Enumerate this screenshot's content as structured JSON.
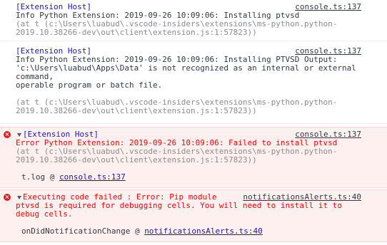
{
  "messages": [
    {
      "source": "console.ts:137",
      "lines": [
        "[Extension Host]",
        "Info Python Extension: 2019-09-26 10:09:06: Installing ptvsd",
        "(at t (c:\\Users\\luabud\\.vscode-insiders\\extensions\\ms-python.python-",
        "2019.10.38266-dev\\out\\client\\extension.js:1:57823))"
      ]
    },
    {
      "source": "console.ts:137",
      "lines": [
        "[Extension Host]",
        "Info Python Extension: 2019-09-26 10:09:06: Installing PTVSD Output:",
        "'c:\\Users\\luabud\\Apps\\Data' is not recognized as an internal or external",
        "command,",
        "operable program or batch file.",
        "(at t (c:\\Users\\luabud\\.vscode-insiders\\extensions\\ms-python.python-",
        "2019.10.38266-dev\\out\\client\\extension.js:1:57823))"
      ]
    },
    {
      "source": "console.ts:137",
      "lines": [
        "[Extension Host]",
        "Error Python Extension: 2019-09-26 10:09:06: Failed to install ptvsd",
        "(at t (c:\\Users\\luabud\\.vscode-insiders\\extensions\\ms-python.python-",
        "2019.10.38266-dev\\out\\client\\extension.js:1:57823))"
      ],
      "stack_prefix": "t.log @ ",
      "stack_link": "console.ts:137"
    },
    {
      "source": "notificationsAlerts.ts:40",
      "lines": [
        "Executing code failed : Error: Pip module",
        "ptvsd is required for debugging cells. You will need to install it to",
        "debug cells."
      ],
      "stack_prefix": "onDidNotificationChange @ ",
      "stack_link": "notificationsAlerts.ts:40"
    }
  ],
  "colors": {
    "error_text": "#ff0000",
    "error_background": "#fff0f0",
    "link": "#1a1aa6",
    "gray": "#8b8b8b"
  },
  "icons": {
    "error": "error-circle-icon",
    "expand": "triangle-down-icon"
  }
}
